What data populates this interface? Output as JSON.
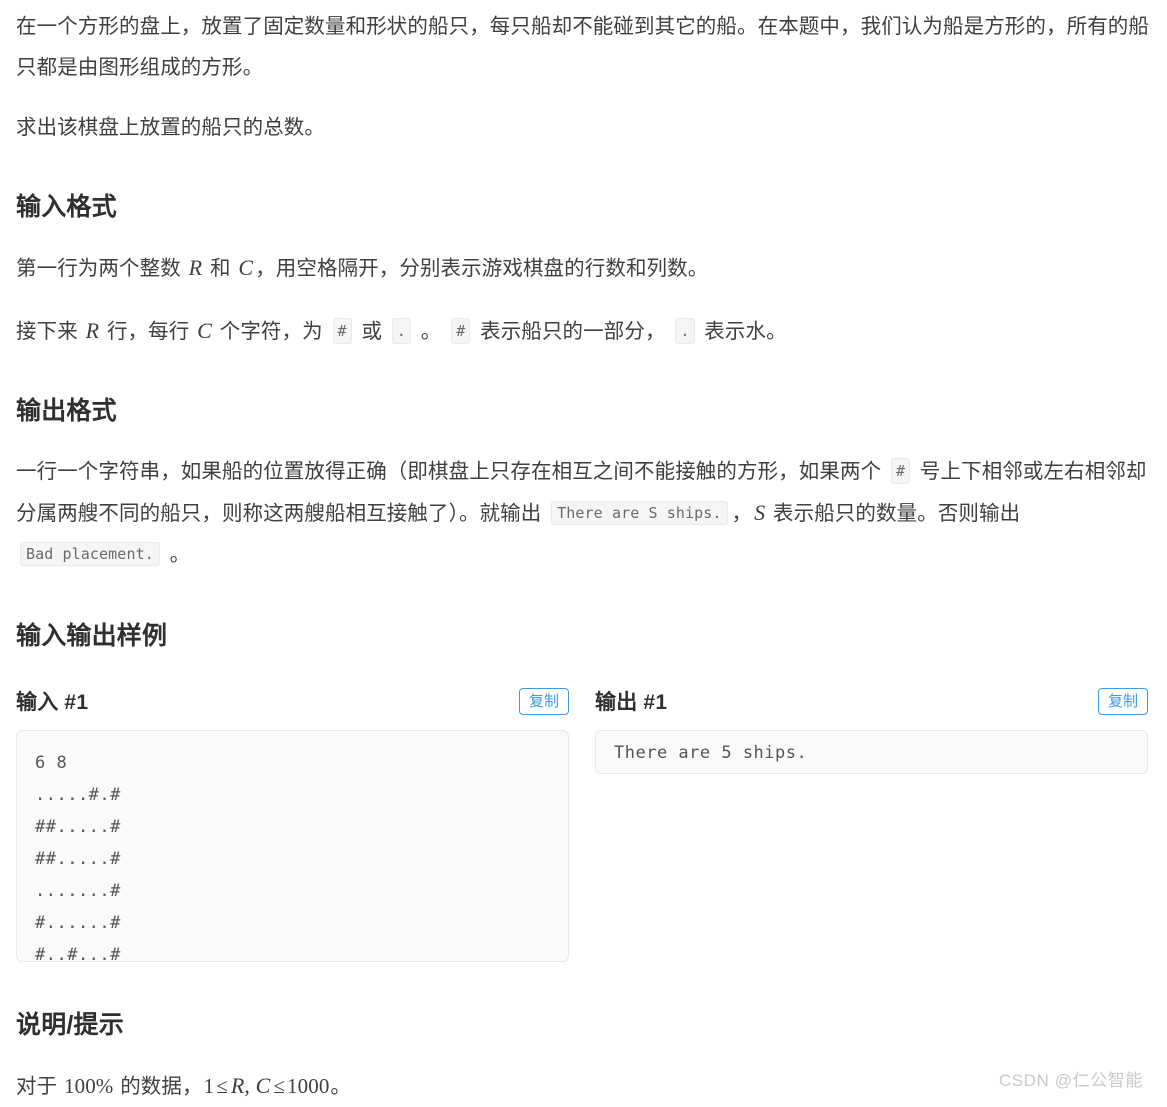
{
  "page": {
    "background": "#ffffff",
    "text_color": "#3f3f3f",
    "accent_color": "#3c9ae8"
  },
  "intro": {
    "paragraph1": "在一个方形的盘上，放置了固定数量和形状的船只，每只船却不能碰到其它的船。在本题中，我们认为船是方形的，所有的船只都是由图形组成的方形。",
    "paragraph2": "求出该棋盘上放置的船只的总数。"
  },
  "input_format": {
    "heading": "输入格式",
    "line1": {
      "t1": "第一行为两个整数 ",
      "m1": "R",
      "t2": " 和 ",
      "m2": "C",
      "t3": "，用空格隔开，分别表示游戏棋盘的行数和列数。"
    },
    "line2": {
      "t1": "接下来 ",
      "m1": "R",
      "t2": " 行，每行 ",
      "m2": "C",
      "t3": " 个字符，为 ",
      "c1": "#",
      "t4": " 或 ",
      "c2": ".",
      "t5": " 。 ",
      "c3": "#",
      "t6": " 表示船只的一部分， ",
      "c4": ".",
      "t7": " 表示水。"
    }
  },
  "output_format": {
    "heading": "输出格式",
    "line": {
      "t1": "一行一个字符串，如果船的位置放得正确（即棋盘上只存在相互之间不能接触的方形，如果两个 ",
      "c1": "#",
      "t2": " 号上下相邻或左右相邻却分属两艘不同的船只，则称这两艘船相互接触了）。就输出 ",
      "c2": "There are S ships.",
      "t3": "，",
      "m1": "S",
      "t4": " 表示船只的数量。否则输出 ",
      "c3": "Bad placement.",
      "t5": " 。"
    }
  },
  "samples": {
    "heading": "输入输出样例",
    "copy_label": "复制",
    "input": {
      "title": "输入 #1",
      "content": "6 8\n.....#.#\n##.....#\n##.....#\n.......#\n#......#\n#..#...#"
    },
    "output": {
      "title": "输出 #1",
      "content": "There are 5 ships."
    }
  },
  "hint": {
    "heading": "说明/提示",
    "line": {
      "t1": "对于 ",
      "m1": "100%",
      "t2": " 的数据，",
      "m2": "1",
      "m3": "≤",
      "m4": "R, C",
      "m5": "≤",
      "m6": "1000",
      "t3": "。"
    }
  },
  "watermark": {
    "text": "CSDN @仁公智能"
  }
}
